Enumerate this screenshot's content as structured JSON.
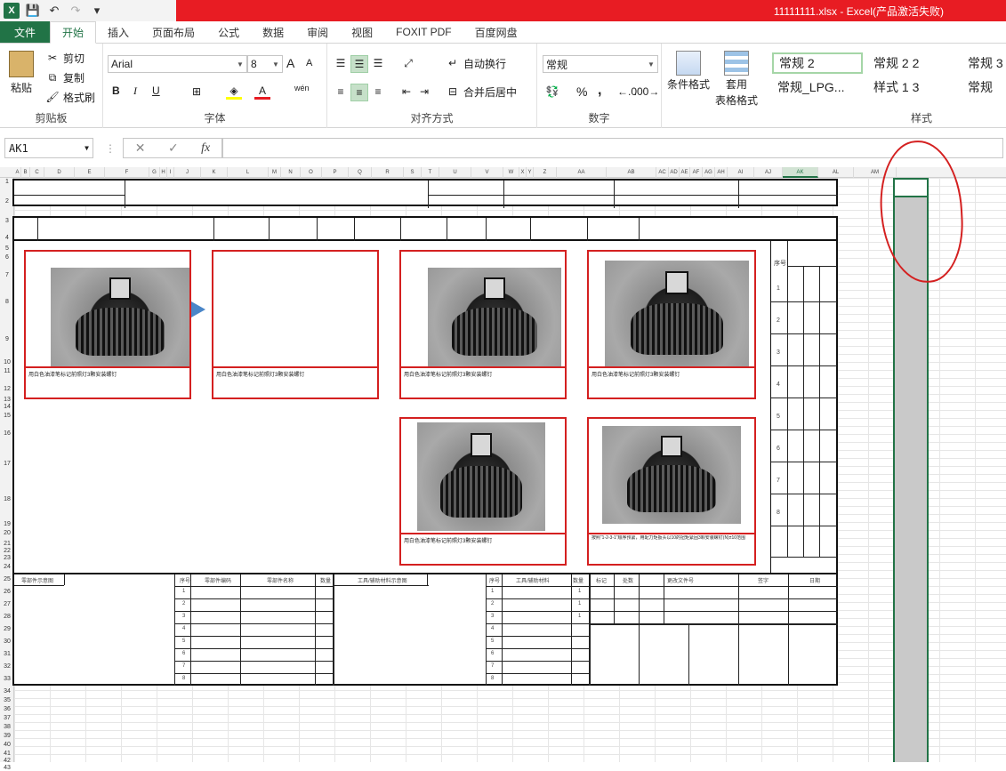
{
  "window": {
    "title": "11111111.xlsx -  Excel(产品激活失败)"
  },
  "qat": {
    "logo": "X",
    "save": "💾",
    "undo": "↶",
    "redo": "↷",
    "more": "▾"
  },
  "tabs": [
    {
      "label": "文件"
    },
    {
      "label": "开始"
    },
    {
      "label": "插入"
    },
    {
      "label": "页面布局"
    },
    {
      "label": "公式"
    },
    {
      "label": "数据"
    },
    {
      "label": "审阅"
    },
    {
      "label": "视图"
    },
    {
      "label": "FOXIT PDF"
    },
    {
      "label": "百度网盘"
    }
  ],
  "ribbon": {
    "clipboard": {
      "paste": "粘贴",
      "cut": "剪切",
      "copy": "复制",
      "format_painter": "格式刷",
      "label": "剪贴板"
    },
    "font": {
      "name": "Arial",
      "size": "8",
      "bold": "B",
      "italic": "I",
      "underline": "U",
      "label": "字体",
      "grow": "A",
      "shrink": "A",
      "wen": "wén"
    },
    "alignment": {
      "wrap": "自动换行",
      "merge": "合并后居中",
      "label": "对齐方式"
    },
    "number": {
      "format": "常规",
      "percent": "%",
      "comma": ",",
      "label": "数字"
    },
    "styles_cmds": {
      "conditional": "条件格式",
      "table": "套用",
      "table2": "表格格式"
    },
    "styles": {
      "cells": [
        "常规 2",
        "常规 2 2",
        "常规 3",
        "常规_LPG...",
        "样式 1 3",
        "常规"
      ],
      "label": "样式"
    }
  },
  "formula_bar": {
    "name_box": "AK1",
    "cancel": "✕",
    "enter": "✓",
    "fx": "fx",
    "value": ""
  },
  "columns": [
    "A",
    "B",
    "C",
    "D",
    "E",
    "F",
    "G",
    "H",
    "I",
    "J",
    "K",
    "L",
    "M",
    "N",
    "O",
    "P",
    "Q",
    "R",
    "S",
    "T",
    "U",
    "V",
    "W",
    "X",
    "Y",
    "Z",
    "AA",
    "AB",
    "AC",
    "AD",
    "AE",
    "AF",
    "AG",
    "AH",
    "AI",
    "AJ",
    "AK",
    "AL",
    "AM"
  ],
  "rows": [
    "1",
    "2",
    "3",
    "4",
    "5",
    "6",
    "7",
    "8",
    "9",
    "10",
    "11",
    "12",
    "13",
    "14",
    "15",
    "16",
    "17",
    "18",
    "19",
    "20",
    "21",
    "22",
    "23",
    "24",
    "25",
    "26",
    "27",
    "28",
    "29",
    "30",
    "31",
    "32",
    "33",
    "34",
    "35",
    "36",
    "37",
    "38",
    "39",
    "40",
    "41",
    "42",
    "43"
  ],
  "sheet": {
    "captions": [
      "用白色油漆笔标记前照灯3颗安装螺钉",
      "用白色油漆笔标记前照灯3颗安装螺钉",
      "用白色油漆笔标记前照灯3颗安装螺钉",
      "用白色油漆笔标记前照灯3颗安装螺钉",
      "用白色油漆笔标记前照灯3颗安装螺钉",
      "按照“1-2-3-1”顺序预紧，用配力矩扳头以10的扭矩紧固3颗安装螺钉(N)±10范围"
    ],
    "seq_header": "序号",
    "seq_numbers": [
      "1",
      "2",
      "3",
      "4",
      "5",
      "6",
      "7",
      "8"
    ],
    "bottom_left_title": "零部件示意图",
    "bottom_mid_title": "工具/辅助材料示意图",
    "parts_headers": [
      "序号",
      "零部件编码",
      "零部件名称",
      "数量"
    ],
    "tools_headers": [
      "序号",
      "工具/辅助材料",
      "数量"
    ],
    "rev_headers": [
      "标记",
      "处数",
      "更改文件号",
      "签字",
      "日期"
    ],
    "parts_rows": [
      "1",
      "2",
      "3",
      "4",
      "5",
      "6",
      "7",
      "8"
    ],
    "tools_qty": [
      "1",
      "1",
      "1"
    ]
  }
}
